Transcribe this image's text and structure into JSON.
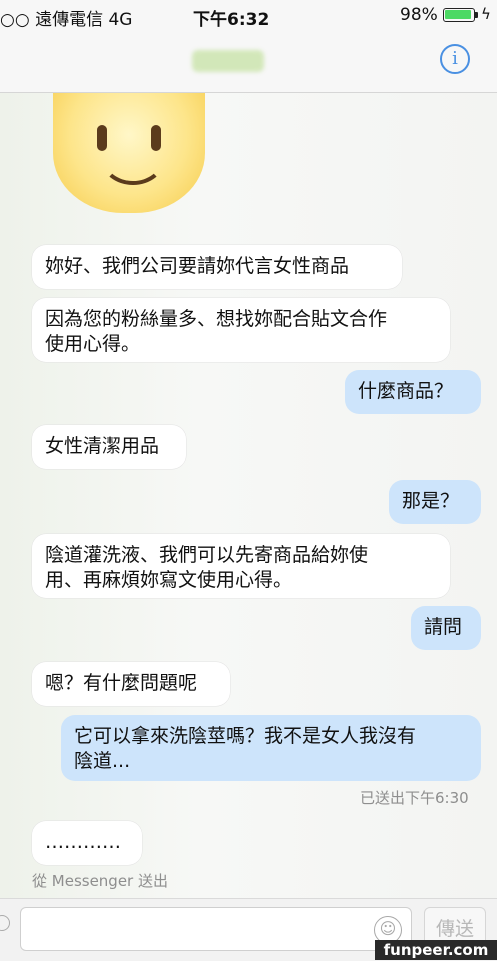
{
  "status_bar": {
    "carrier": "○○ 遠傳電信  4G",
    "time": "下午6:32",
    "battery": "98%",
    "battery_level": 0.98
  },
  "nav": {
    "info_label": "i"
  },
  "messages": [
    {
      "side": "in",
      "text": "妳好、我們公司要請妳代言女性商品"
    },
    {
      "side": "in",
      "text": "因為您的粉絲量多、想找妳配合貼文合作\n使用心得。"
    },
    {
      "side": "out",
      "text": "什麼商品？"
    },
    {
      "side": "in",
      "text": "女性清潔用品"
    },
    {
      "side": "out",
      "text": "那是？"
    },
    {
      "side": "in",
      "text": "陰道灌洗液、我們可以先寄商品給妳使\n用、再麻煩妳寫文使用心得。"
    },
    {
      "side": "out",
      "text": "請問"
    },
    {
      "side": "in",
      "text": "嗯？有什麼問題呢"
    },
    {
      "side": "out",
      "text": "它可以拿來洗陰莖嗎？我不是女人我沒有\n陰道..."
    },
    {
      "side": "in",
      "text": "…………"
    }
  ],
  "sent_status": "已送出下午6:30",
  "sent_via": "從 Messenger 送出",
  "composer": {
    "send_label": "傳送"
  },
  "watermark": "funpeer.com",
  "colors": {
    "outgoing_bubble": "#cde4fb",
    "incoming_bubble": "#ffffff",
    "accent": "#4a90e2",
    "battery": "#4cd964"
  }
}
